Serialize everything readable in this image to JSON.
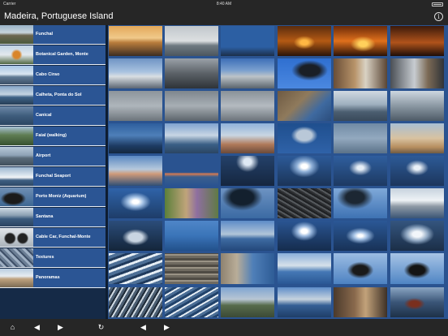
{
  "status": {
    "carrier": "Carrier",
    "time": "8:40 AM"
  },
  "header": {
    "title": "Madeira, Portuguese Island",
    "info_glyph": "i"
  },
  "sidebar": {
    "items": [
      {
        "label": "Funchal",
        "icon": "funchal-thumbnail"
      },
      {
        "label": "Botanical Garden, Monte",
        "icon": "botanical-garden-thumbnail"
      },
      {
        "label": "Cabo Cirao",
        "icon": "cabo-cirao-thumbnail"
      },
      {
        "label": "Calheta, Ponta do Sol",
        "icon": "calheta-thumbnail"
      },
      {
        "label": "Canical",
        "icon": "canical-thumbnail"
      },
      {
        "label": "Faial (walking)",
        "icon": "faial-thumbnail"
      },
      {
        "label": "Airport",
        "icon": "airport-thumbnail"
      },
      {
        "label": "Funchal Seaport",
        "icon": "seaport-thumbnail"
      },
      {
        "label": "Porto Moniz (Aquarium)",
        "icon": "porto-moniz-thumbnail"
      },
      {
        "label": "Santana",
        "icon": "santana-thumbnail"
      },
      {
        "label": "Cable Car, Funchal-Monte",
        "icon": "cable-car-thumbnail"
      },
      {
        "label": "Textures",
        "icon": "textures-thumbnail"
      },
      {
        "label": "Panoramas",
        "icon": "panoramas-thumbnail"
      }
    ]
  },
  "toolbar": {
    "home": "⌂",
    "back": "◀",
    "forward": "▶",
    "reload": "↻",
    "page_back": "◀",
    "page_forward": "▶"
  },
  "colors": {
    "bar": "#262626",
    "sidebar_item": "#2b5594",
    "grid_bg": "#2a5390"
  }
}
